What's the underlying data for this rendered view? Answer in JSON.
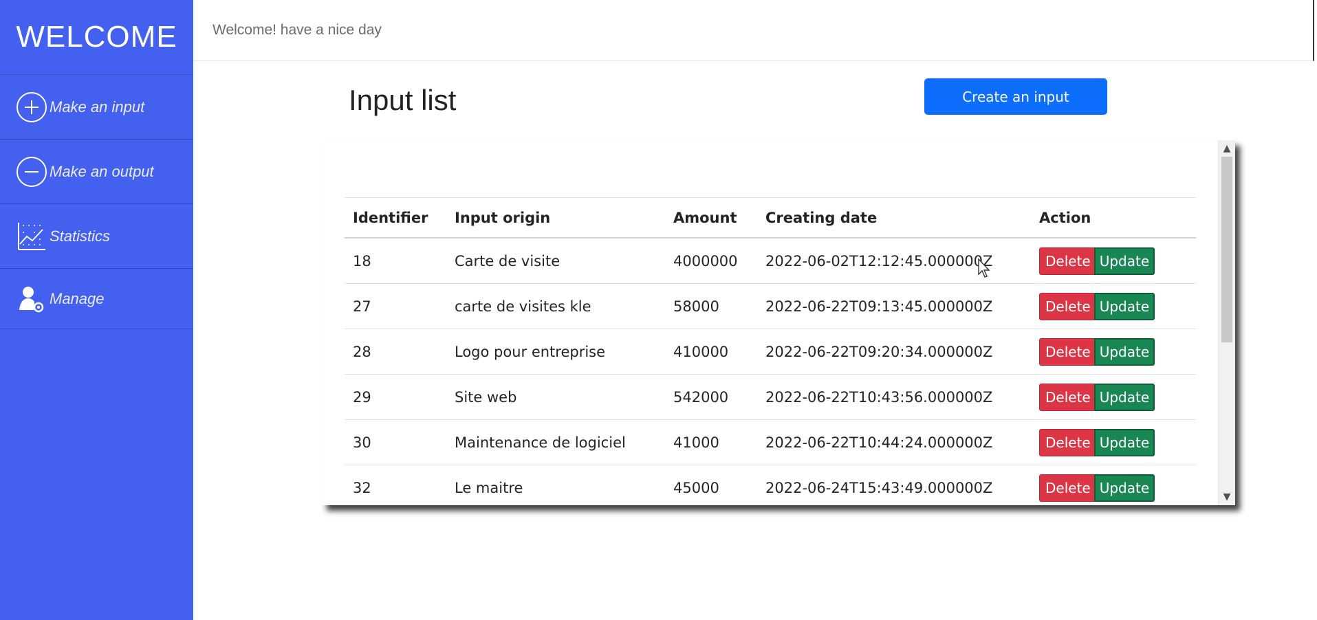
{
  "sidebar": {
    "brand": "WELCOME",
    "items": [
      {
        "label": "Make an input",
        "icon": "plus-circle-icon"
      },
      {
        "label": "Make an output",
        "icon": "minus-circle-icon"
      },
      {
        "label": "Statistics",
        "icon": "chart-icon"
      },
      {
        "label": "Manage",
        "icon": "user-gear-icon"
      }
    ]
  },
  "header": {
    "welcome": "Welcome! have a nice day"
  },
  "main": {
    "title": "Input list",
    "create_label": "Create an input",
    "table": {
      "columns": [
        "Identifier",
        "Input origin",
        "Amount",
        "Creating date",
        "Action"
      ],
      "rows": [
        {
          "id": "18",
          "origin": "Carte de visite",
          "amount": "4000000",
          "date": "2022-06-02T12:12:45.000000Z"
        },
        {
          "id": "27",
          "origin": "carte de visites kle",
          "amount": "58000",
          "date": "2022-06-22T09:13:45.000000Z"
        },
        {
          "id": "28",
          "origin": "Logo pour entreprise",
          "amount": "410000",
          "date": "2022-06-22T09:20:34.000000Z"
        },
        {
          "id": "29",
          "origin": "Site web",
          "amount": "542000",
          "date": "2022-06-22T10:43:56.000000Z"
        },
        {
          "id": "30",
          "origin": "Maintenance de logiciel",
          "amount": "41000",
          "date": "2022-06-22T10:44:24.000000Z"
        },
        {
          "id": "32",
          "origin": "Le maitre",
          "amount": "45000",
          "date": "2022-06-24T15:43:49.000000Z"
        }
      ],
      "delete_label": "Delete",
      "update_label": "Update"
    }
  },
  "colors": {
    "sidebar": "#4460ef",
    "primary": "#0d6efd",
    "danger": "#dc3545",
    "success": "#198754"
  }
}
